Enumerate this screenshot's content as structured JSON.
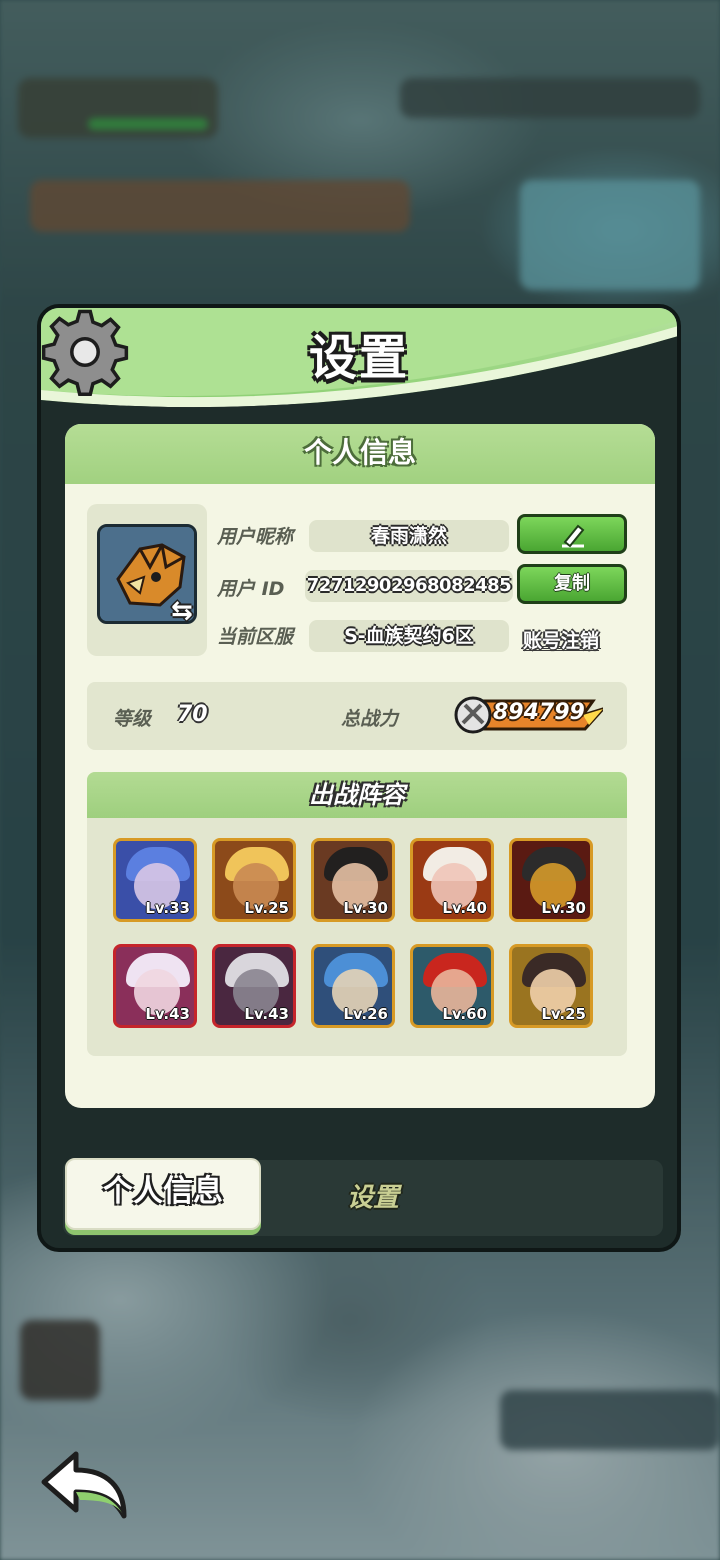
{
  "panel": {
    "title": "设置",
    "card_title": "个人信息"
  },
  "profile": {
    "nickname_label": "用户昵称",
    "nickname": "春雨潇然",
    "id_label": "用户 ID",
    "id": "7271290296808​2485",
    "server_label": "当前区服",
    "server": "S-血族契约6区",
    "copy_label": "复制",
    "logout_label": "账号注销"
  },
  "stats": {
    "level_label": "等级",
    "level": "70",
    "power_label": "总战力",
    "power": "894799"
  },
  "lineup": {
    "title": "出战阵容",
    "heroes": [
      {
        "lv": "Lv.33",
        "frame": "gold",
        "bg": "#3a4fa8",
        "hair": "#5b7fe0",
        "face": "#d8c6e6"
      },
      {
        "lv": "Lv.25",
        "frame": "gold",
        "bg": "#8c4a1a",
        "hair": "#f0c45a",
        "face": "#c98a52"
      },
      {
        "lv": "Lv.30",
        "frame": "gold",
        "bg": "#6a3a22",
        "hair": "#22201f",
        "face": "#e5c0a3"
      },
      {
        "lv": "Lv.40",
        "frame": "gold",
        "bg": "#9a3a14",
        "hair": "#f2ece4",
        "face": "#f0c5b8"
      },
      {
        "lv": "Lv.30",
        "frame": "gold",
        "bg": "#5a1a12",
        "hair": "#2c2b2b",
        "face": "#d59a2a"
      },
      {
        "lv": "Lv.43",
        "frame": "red",
        "bg": "#8a2f5a",
        "hair": "#efe3f2",
        "face": "#f0d6e0"
      },
      {
        "lv": "Lv.43",
        "frame": "red",
        "bg": "#4a2740",
        "hair": "#d9d6dc",
        "face": "#8a8590"
      },
      {
        "lv": "Lv.26",
        "frame": "gold",
        "bg": "#2f4f7a",
        "hair": "#4c8fd6",
        "face": "#e6d3b6"
      },
      {
        "lv": "Lv.60",
        "frame": "gold",
        "bg": "#2d5a6a",
        "hair": "#c9261e",
        "face": "#e9b59a"
      },
      {
        "lv": "Lv.25",
        "frame": "gold",
        "bg": "#9a7420",
        "hair": "#3a2a26",
        "face": "#f0cfaa"
      }
    ]
  },
  "tabs": {
    "active": "个人信息",
    "inactive": "设置"
  }
}
